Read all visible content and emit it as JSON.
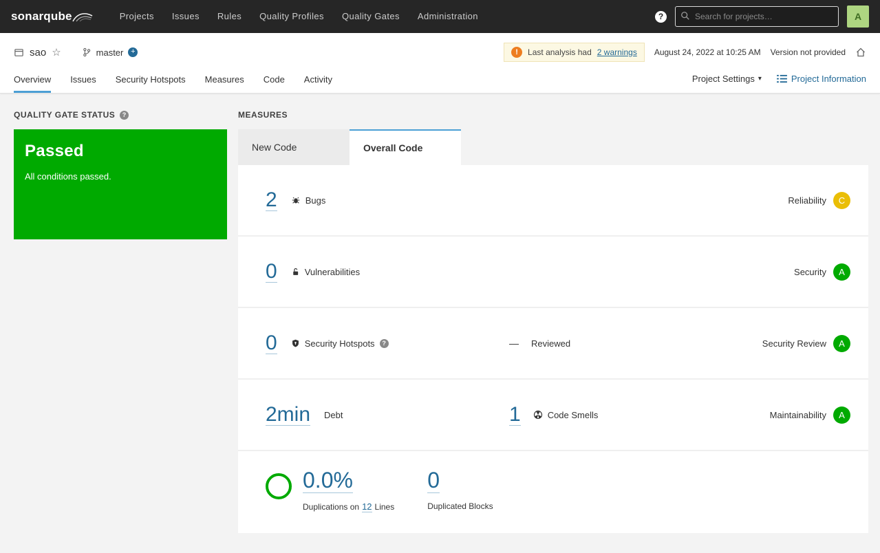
{
  "navbar": {
    "brand": "sonarqube",
    "items": [
      "Projects",
      "Issues",
      "Rules",
      "Quality Profiles",
      "Quality Gates",
      "Administration"
    ],
    "search_placeholder": "Search for projects…",
    "avatar_letter": "A"
  },
  "icons": {
    "help": "?",
    "warning": "!",
    "star": "☆",
    "plus": "+",
    "caret_down": "▾"
  },
  "header": {
    "project_name": "sao",
    "branch_name": "master",
    "warning_text": "Last analysis had",
    "warning_link": "2 warnings",
    "analysis_date": "August 24, 2022 at 10:25 AM",
    "version_text": "Version not provided"
  },
  "project_nav": {
    "tabs": [
      "Overview",
      "Issues",
      "Security Hotspots",
      "Measures",
      "Code",
      "Activity"
    ],
    "active_tab": "Overview",
    "settings_label": "Project Settings",
    "information_label": "Project Information"
  },
  "quality_gate": {
    "heading": "QUALITY GATE STATUS",
    "status": "Passed",
    "description": "All conditions passed."
  },
  "measures": {
    "heading": "MEASURES",
    "tabs": {
      "new_code": "New Code",
      "overall_code": "Overall Code"
    },
    "active_tab": "Overall Code",
    "rows": {
      "bugs": {
        "value": "2",
        "label": "Bugs",
        "domain": "Reliability",
        "rating": "C"
      },
      "vulnerabilities": {
        "value": "0",
        "label": "Vulnerabilities",
        "domain": "Security",
        "rating": "A"
      },
      "hotspots": {
        "value": "0",
        "label": "Security Hotspots",
        "reviewed_value": "—",
        "reviewed_label": "Reviewed",
        "domain": "Security Review",
        "rating": "A"
      },
      "maintainability": {
        "debt_value": "2min",
        "debt_label": "Debt",
        "smells_value": "1",
        "smells_label": "Code Smells",
        "domain": "Maintainability",
        "rating": "A"
      },
      "duplications": {
        "value": "0.0%",
        "caption_prefix": "Duplications on",
        "lines_link": "12",
        "caption_suffix": "Lines",
        "blocks_value": "0",
        "blocks_label": "Duplicated Blocks"
      }
    }
  },
  "colors": {
    "rating_a": "#00aa00",
    "rating_c": "#eabe06",
    "passed_green": "#00aa00",
    "link_blue": "#236a97",
    "active_tab_blue": "#4b9fd5",
    "warning_orange": "#ed7d20"
  }
}
